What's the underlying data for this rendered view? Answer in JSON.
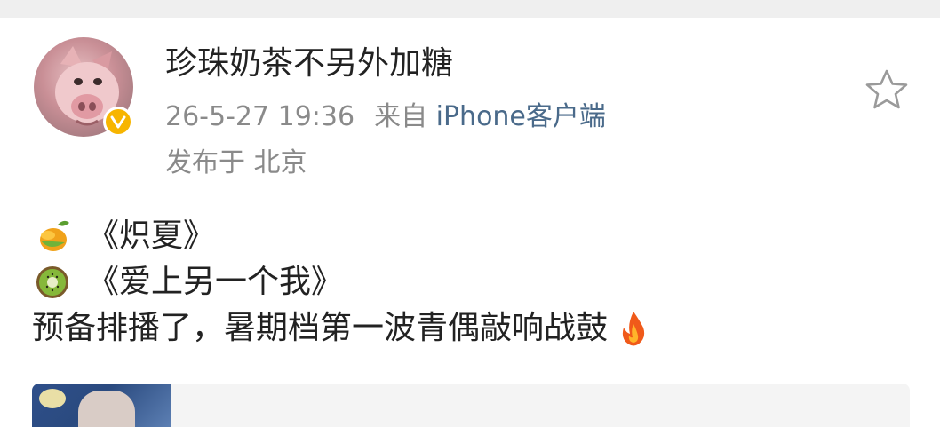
{
  "post": {
    "author": {
      "name": "珍珠奶茶不另外加糖",
      "avatar_icon": "pig-avatar",
      "verified_color": "#f7b500"
    },
    "meta": {
      "timestamp": "26-5-27 19:36",
      "source_prefix": "来自",
      "source": "iPhone客户端",
      "location": "发布于 北京"
    },
    "favorite_icon": "star-outline-icon",
    "content": {
      "lines": [
        {
          "emoji": "mango-emoji",
          "text": "《炽夏》"
        },
        {
          "emoji": "kiwi-emoji",
          "text": "《爱上另一个我》"
        },
        {
          "text": "预备排播了，暑期档第一波青偶敲响战鼓",
          "emoji_after": "fire-emoji"
        }
      ]
    }
  },
  "colors": {
    "text_primary": "#222222",
    "text_secondary": "#8a8a8a",
    "link": "#4a6a8a",
    "verified": "#f7b500"
  }
}
